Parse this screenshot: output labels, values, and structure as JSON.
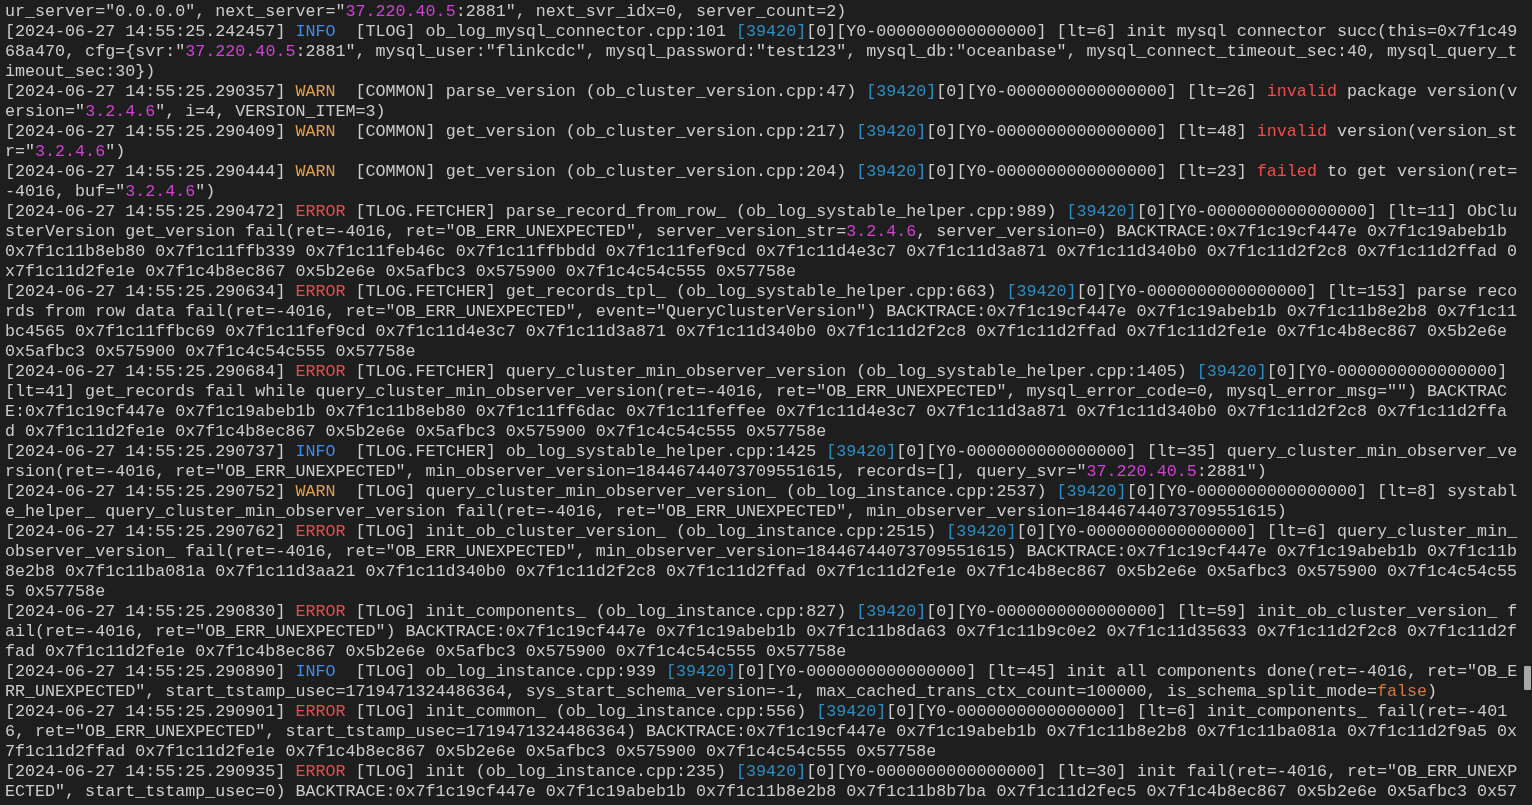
{
  "log_lines": [
    {
      "segments": [
        {
          "kind": "text",
          "text": "ur_server=\"0.0.0.0\", next_server=\""
        },
        {
          "kind": "value",
          "text": "37.220.40.5"
        },
        {
          "kind": "text",
          "text": ":2881\", next_svr_idx=0, server_count=2)"
        }
      ]
    },
    {
      "segments": [
        {
          "kind": "text",
          "text": "[2024-06-27 14:55:25.242457] "
        },
        {
          "kind": "info",
          "text": "INFO"
        },
        {
          "kind": "text",
          "text": "  [TLOG] ob_log_mysql_connector.cpp:101 "
        },
        {
          "kind": "pid",
          "text": "[39420]"
        },
        {
          "kind": "text",
          "text": "[0][Y0-0000000000000000] [lt=6] init mysql connector succ(this=0x7f1c4968a470, cfg={svr:\""
        },
        {
          "kind": "value",
          "text": "37.220.40.5"
        },
        {
          "kind": "text",
          "text": ":2881\", mysql_user:\"flinkcdc\", mysql_password:\"test123\", mysql_db:\"oceanbase\", mysql_connect_timeout_sec:40, mysql_query_timeout_sec:30})"
        }
      ]
    },
    {
      "segments": [
        {
          "kind": "text",
          "text": "[2024-06-27 14:55:25.290357] "
        },
        {
          "kind": "warn",
          "text": "WARN"
        },
        {
          "kind": "text",
          "text": "  [COMMON] parse_version (ob_cluster_version.cpp:47) "
        },
        {
          "kind": "pid",
          "text": "[39420]"
        },
        {
          "kind": "text",
          "text": "[0][Y0-0000000000000000] [lt=26] "
        },
        {
          "kind": "bad",
          "text": "invalid"
        },
        {
          "kind": "text",
          "text": " package version(version=\""
        },
        {
          "kind": "value",
          "text": "3.2.4.6"
        },
        {
          "kind": "text",
          "text": "\", i=4, VERSION_ITEM=3)"
        }
      ]
    },
    {
      "segments": [
        {
          "kind": "text",
          "text": "[2024-06-27 14:55:25.290409] "
        },
        {
          "kind": "warn",
          "text": "WARN"
        },
        {
          "kind": "text",
          "text": "  [COMMON] get_version (ob_cluster_version.cpp:217) "
        },
        {
          "kind": "pid",
          "text": "[39420]"
        },
        {
          "kind": "text",
          "text": "[0][Y0-0000000000000000] [lt=48] "
        },
        {
          "kind": "bad",
          "text": "invalid"
        },
        {
          "kind": "text",
          "text": " version(version_str=\""
        },
        {
          "kind": "value",
          "text": "3.2.4.6"
        },
        {
          "kind": "text",
          "text": "\")"
        }
      ]
    },
    {
      "segments": [
        {
          "kind": "text",
          "text": "[2024-06-27 14:55:25.290444] "
        },
        {
          "kind": "warn",
          "text": "WARN"
        },
        {
          "kind": "text",
          "text": "  [COMMON] get_version (ob_cluster_version.cpp:204) "
        },
        {
          "kind": "pid",
          "text": "[39420]"
        },
        {
          "kind": "text",
          "text": "[0][Y0-0000000000000000] [lt=23] "
        },
        {
          "kind": "bad",
          "text": "failed"
        },
        {
          "kind": "text",
          "text": " to get version(ret=-4016, buf=\""
        },
        {
          "kind": "value",
          "text": "3.2.4.6"
        },
        {
          "kind": "text",
          "text": "\")"
        }
      ]
    },
    {
      "segments": [
        {
          "kind": "text",
          "text": "[2024-06-27 14:55:25.290472] "
        },
        {
          "kind": "error",
          "text": "ERROR"
        },
        {
          "kind": "text",
          "text": " [TLOG.FETCHER] parse_record_from_row_ (ob_log_systable_helper.cpp:989) "
        },
        {
          "kind": "pid",
          "text": "[39420]"
        },
        {
          "kind": "text",
          "text": "[0][Y0-0000000000000000] [lt=11] ObClusterVersion get_version fail(ret=-4016, ret=\"OB_ERR_UNEXPECTED\", server_version_str="
        },
        {
          "kind": "value",
          "text": "3.2.4.6"
        },
        {
          "kind": "text",
          "text": ", server_version=0) BACKTRACE:0x7f1c19cf447e 0x7f1c19abeb1b 0x7f1c11b8eb80 0x7f1c11ffb339 0x7f1c11feb46c 0x7f1c11ffbbdd 0x7f1c11fef9cd 0x7f1c11d4e3c7 0x7f1c11d3a871 0x7f1c11d340b0 0x7f1c11d2f2c8 0x7f1c11d2ffad 0x7f1c11d2fe1e 0x7f1c4b8ec867 0x5b2e6e 0x5afbc3 0x575900 0x7f1c4c54c555 0x57758e"
        }
      ]
    },
    {
      "segments": [
        {
          "kind": "text",
          "text": "[2024-06-27 14:55:25.290634] "
        },
        {
          "kind": "error",
          "text": "ERROR"
        },
        {
          "kind": "text",
          "text": " [TLOG.FETCHER] get_records_tpl_ (ob_log_systable_helper.cpp:663) "
        },
        {
          "kind": "pid",
          "text": "[39420]"
        },
        {
          "kind": "text",
          "text": "[0][Y0-0000000000000000] [lt=153] parse records from row data fail(ret=-4016, ret=\"OB_ERR_UNEXPECTED\", event=\"QueryClusterVersion\") BACKTRACE:0x7f1c19cf447e 0x7f1c19abeb1b 0x7f1c11b8e2b8 0x7f1c11bc4565 0x7f1c11ffbc69 0x7f1c11fef9cd 0x7f1c11d4e3c7 0x7f1c11d3a871 0x7f1c11d340b0 0x7f1c11d2f2c8 0x7f1c11d2ffad 0x7f1c11d2fe1e 0x7f1c4b8ec867 0x5b2e6e 0x5afbc3 0x575900 0x7f1c4c54c555 0x57758e"
        }
      ]
    },
    {
      "segments": [
        {
          "kind": "text",
          "text": "[2024-06-27 14:55:25.290684] "
        },
        {
          "kind": "error",
          "text": "ERROR"
        },
        {
          "kind": "text",
          "text": " [TLOG.FETCHER] query_cluster_min_observer_version (ob_log_systable_helper.cpp:1405) "
        },
        {
          "kind": "pid",
          "text": "[39420]"
        },
        {
          "kind": "text",
          "text": "[0][Y0-0000000000000000] [lt=41] get_records fail while query_cluster_min_observer_version(ret=-4016, ret=\"OB_ERR_UNEXPECTED\", mysql_error_code=0, mysql_error_msg=\"\") BACKTRACE:0x7f1c19cf447e 0x7f1c19abeb1b 0x7f1c11b8eb80 0x7f1c11ff6dac 0x7f1c11feffee 0x7f1c11d4e3c7 0x7f1c11d3a871 0x7f1c11d340b0 0x7f1c11d2f2c8 0x7f1c11d2ffad 0x7f1c11d2fe1e 0x7f1c4b8ec867 0x5b2e6e 0x5afbc3 0x575900 0x7f1c4c54c555 0x57758e"
        }
      ]
    },
    {
      "segments": [
        {
          "kind": "text",
          "text": "[2024-06-27 14:55:25.290737] "
        },
        {
          "kind": "info",
          "text": "INFO"
        },
        {
          "kind": "text",
          "text": "  [TLOG.FETCHER] ob_log_systable_helper.cpp:1425 "
        },
        {
          "kind": "pid",
          "text": "[39420]"
        },
        {
          "kind": "text",
          "text": "[0][Y0-0000000000000000] [lt=35] query_cluster_min_observer_version(ret=-4016, ret=\"OB_ERR_UNEXPECTED\", min_observer_version=18446744073709551615, records=[], query_svr=\""
        },
        {
          "kind": "value",
          "text": "37.220.40.5"
        },
        {
          "kind": "text",
          "text": ":2881\")"
        }
      ]
    },
    {
      "segments": [
        {
          "kind": "text",
          "text": "[2024-06-27 14:55:25.290752] "
        },
        {
          "kind": "warn",
          "text": "WARN"
        },
        {
          "kind": "text",
          "text": "  [TLOG] query_cluster_min_observer_version_ (ob_log_instance.cpp:2537) "
        },
        {
          "kind": "pid",
          "text": "[39420]"
        },
        {
          "kind": "text",
          "text": "[0][Y0-0000000000000000] [lt=8] systable_helper_ query_cluster_min_observer_version fail(ret=-4016, ret=\"OB_ERR_UNEXPECTED\", min_observer_version=18446744073709551615)"
        }
      ]
    },
    {
      "segments": [
        {
          "kind": "text",
          "text": "[2024-06-27 14:55:25.290762] "
        },
        {
          "kind": "error",
          "text": "ERROR"
        },
        {
          "kind": "text",
          "text": " [TLOG] init_ob_cluster_version_ (ob_log_instance.cpp:2515) "
        },
        {
          "kind": "pid",
          "text": "[39420]"
        },
        {
          "kind": "text",
          "text": "[0][Y0-0000000000000000] [lt=6] query_cluster_min_observer_version_ fail(ret=-4016, ret=\"OB_ERR_UNEXPECTED\", min_observer_version=18446744073709551615) BACKTRACE:0x7f1c19cf447e 0x7f1c19abeb1b 0x7f1c11b8e2b8 0x7f1c11ba081a 0x7f1c11d3aa21 0x7f1c11d340b0 0x7f1c11d2f2c8 0x7f1c11d2ffad 0x7f1c11d2fe1e 0x7f1c4b8ec867 0x5b2e6e 0x5afbc3 0x575900 0x7f1c4c54c555 0x57758e"
        }
      ]
    },
    {
      "segments": [
        {
          "kind": "text",
          "text": "[2024-06-27 14:55:25.290830] "
        },
        {
          "kind": "error",
          "text": "ERROR"
        },
        {
          "kind": "text",
          "text": " [TLOG] init_components_ (ob_log_instance.cpp:827) "
        },
        {
          "kind": "pid",
          "text": "[39420]"
        },
        {
          "kind": "text",
          "text": "[0][Y0-0000000000000000] [lt=59] init_ob_cluster_version_ fail(ret=-4016, ret=\"OB_ERR_UNEXPECTED\") BACKTRACE:0x7f1c19cf447e 0x7f1c19abeb1b 0x7f1c11b8da63 0x7f1c11b9c0e2 0x7f1c11d35633 0x7f1c11d2f2c8 0x7f1c11d2ffad 0x7f1c11d2fe1e 0x7f1c4b8ec867 0x5b2e6e 0x5afbc3 0x575900 0x7f1c4c54c555 0x57758e"
        }
      ]
    },
    {
      "segments": [
        {
          "kind": "text",
          "text": "[2024-06-27 14:55:25.290890] "
        },
        {
          "kind": "info",
          "text": "INFO"
        },
        {
          "kind": "text",
          "text": "  [TLOG] ob_log_instance.cpp:939 "
        },
        {
          "kind": "pid",
          "text": "[39420]"
        },
        {
          "kind": "text",
          "text": "[0][Y0-0000000000000000] [lt=45] init all components done(ret=-4016, ret=\"OB_ERR_UNEXPECTED\", start_tstamp_usec=1719471324486364, sys_start_schema_version=-1, max_cached_trans_ctx_count=100000, is_schema_split_mode="
        },
        {
          "kind": "bool",
          "text": "false"
        },
        {
          "kind": "text",
          "text": ")"
        }
      ]
    },
    {
      "segments": [
        {
          "kind": "text",
          "text": "[2024-06-27 14:55:25.290901] "
        },
        {
          "kind": "error",
          "text": "ERROR"
        },
        {
          "kind": "text",
          "text": " [TLOG] init_common_ (ob_log_instance.cpp:556) "
        },
        {
          "kind": "pid",
          "text": "[39420]"
        },
        {
          "kind": "text",
          "text": "[0][Y0-0000000000000000] [lt=6] init_components_ fail(ret=-4016, ret=\"OB_ERR_UNEXPECTED\", start_tstamp_usec=1719471324486364) BACKTRACE:0x7f1c19cf447e 0x7f1c19abeb1b 0x7f1c11b8e2b8 0x7f1c11ba081a 0x7f1c11d2f9a5 0x7f1c11d2ffad 0x7f1c11d2fe1e 0x7f1c4b8ec867 0x5b2e6e 0x5afbc3 0x575900 0x7f1c4c54c555 0x57758e"
        }
      ]
    },
    {
      "segments": [
        {
          "kind": "text",
          "text": "[2024-06-27 14:55:25.290935] "
        },
        {
          "kind": "error",
          "text": "ERROR"
        },
        {
          "kind": "text",
          "text": " [TLOG] init (ob_log_instance.cpp:235) "
        },
        {
          "kind": "pid",
          "text": "[39420]"
        },
        {
          "kind": "text",
          "text": "[0][Y0-0000000000000000] [lt=30] init fail(ret=-4016, ret=\"OB_ERR_UNEXPECTED\", start_tstamp_usec=0) BACKTRACE:0x7f1c19cf447e 0x7f1c19abeb1b 0x7f1c11b8e2b8 0x7f1c11b8b7ba 0x7f1c11d2fec5 0x7f1c4b8ec867 0x5b2e6e 0x5afbc3 0x57"
        }
      ]
    }
  ]
}
